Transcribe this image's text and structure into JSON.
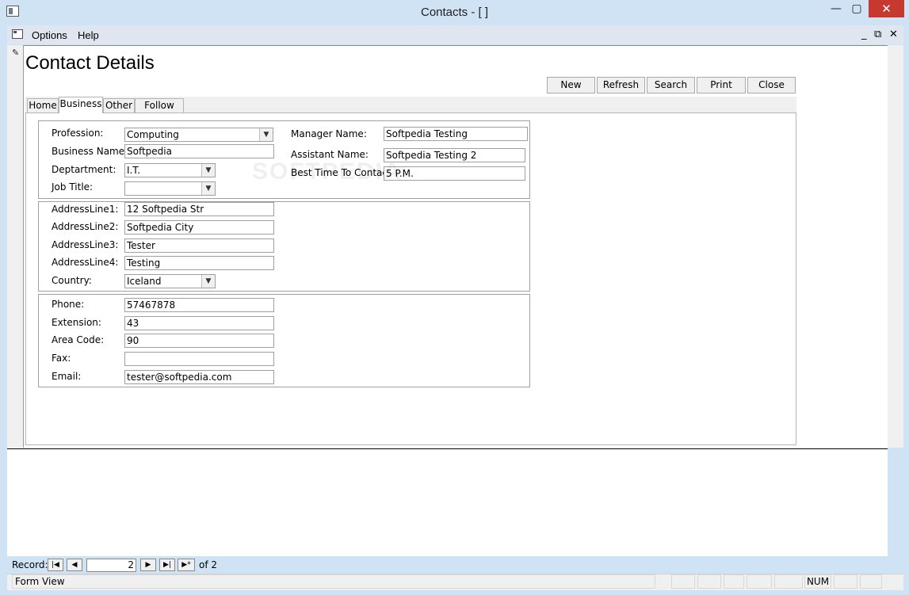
{
  "window": {
    "title": "Contacts - [ ]",
    "minimize": "—",
    "maximize": "▢",
    "close": "✕"
  },
  "menu": {
    "items": [
      {
        "label": "Options"
      },
      {
        "label": "Help"
      }
    ],
    "mdi_minimize": "_",
    "mdi_restore": "⧉",
    "mdi_close": "✕"
  },
  "form": {
    "title": "Contact Details",
    "watermark": "SOFTPEDIA",
    "buttons": {
      "new": "New",
      "refresh": "Refresh",
      "search": "Search",
      "print": "Print",
      "close": "Close"
    },
    "tabs": [
      "Home",
      "Business",
      "Other",
      "Follow Ups"
    ],
    "active_tab": "Business"
  },
  "business": {
    "profession_label": "Profession:",
    "profession_value": "Computing",
    "business_name_label": "Business Name:",
    "business_name_value": "Softpedia",
    "department_label": "Deptartment:",
    "department_value": "I.T.",
    "job_title_label": "Job Title:",
    "job_title_value": "",
    "manager_name_label": "Manager Name:",
    "manager_name_value": "Softpedia Testing",
    "assistant_name_label": "Assistant Name:",
    "assistant_name_value": "Softpedia Testing 2",
    "best_time_label": "Best Time To Contact:",
    "best_time_value": "5 P.M."
  },
  "address": {
    "line1_label": "AddressLine1:",
    "line1_value": "12  Softpedia Str",
    "line2_label": "AddressLine2:",
    "line2_value": "Softpedia City",
    "line3_label": "AddressLine3:",
    "line3_value": "Tester",
    "line4_label": "AddressLine4:",
    "line4_value": "Testing",
    "country_label": "Country:",
    "country_value": "Iceland"
  },
  "contact": {
    "phone_label": "Phone:",
    "phone_value": "57467878",
    "extension_label": "Extension:",
    "extension_value": "43",
    "area_code_label": "Area Code:",
    "area_code_value": "90",
    "fax_label": "Fax:",
    "fax_value": "",
    "email_label": "Email:",
    "email_value": "tester@softpedia.com"
  },
  "record_nav": {
    "label": "Record:",
    "current": "2",
    "of_label": "of  2",
    "first": "|◀",
    "prev": "◀",
    "next": "▶",
    "last": "▶|",
    "new": "▶*"
  },
  "status": {
    "text": "Form View",
    "num": "NUM"
  }
}
